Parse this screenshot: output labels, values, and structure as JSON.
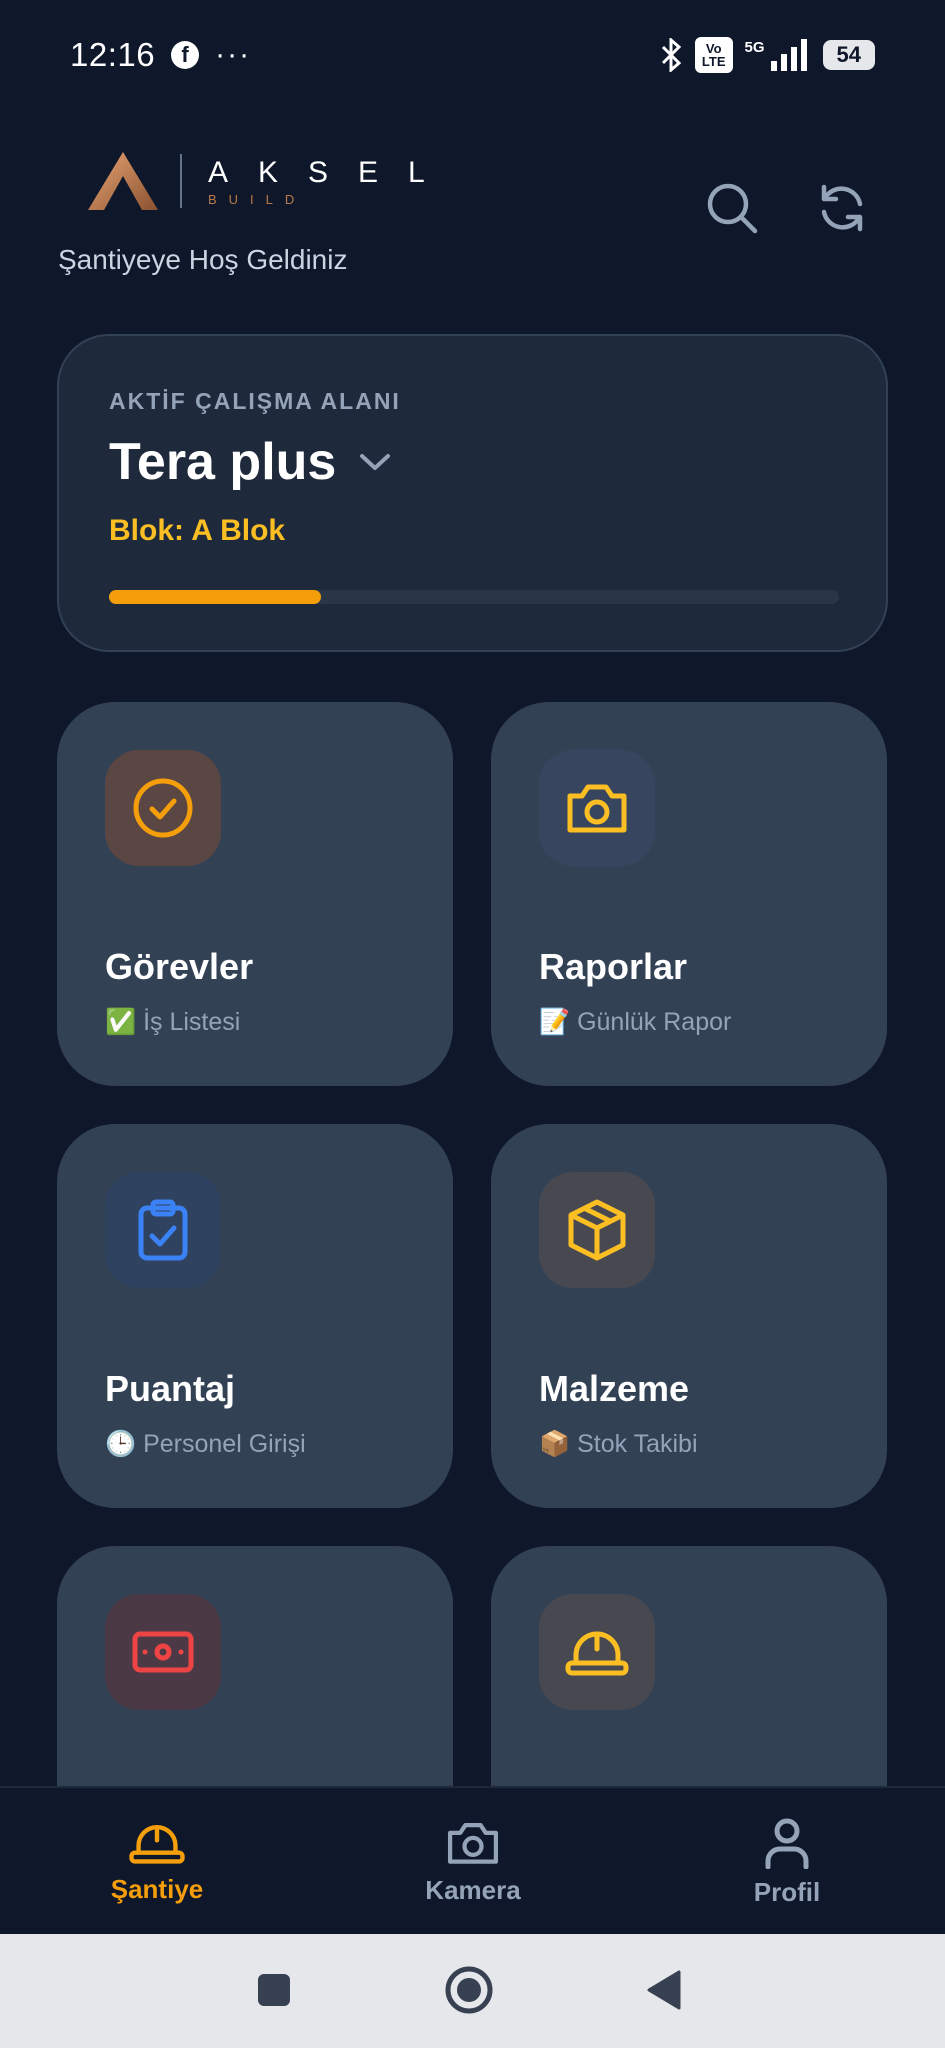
{
  "status_bar": {
    "time": "12:16",
    "fb_glyph": "f",
    "more": "···",
    "volte_top": "Vo",
    "volte_bottom": "LTE",
    "network": "5G",
    "battery": "54"
  },
  "header": {
    "logo_word": "AKSEL",
    "logo_sub": "BUILD",
    "welcome": "Şantiyeye Hoş Geldiniz",
    "icons": [
      "search-icon",
      "refresh-icon"
    ]
  },
  "workspace": {
    "label": "AKTİF ÇALIŞMA ALANI",
    "name": "Tera plus",
    "block": "Blok: A Blok",
    "progress": 0.29,
    "accent": "#f59e0b"
  },
  "tiles": [
    {
      "title": "Görevler",
      "subtitle": "✅ İş Listesi",
      "icon": "check-circle-icon",
      "color": "#f59e0b"
    },
    {
      "title": "Raporlar",
      "subtitle": "📝 Günlük Rapor",
      "icon": "camera-icon",
      "color": "#fbbf24"
    },
    {
      "title": "Puantaj",
      "subtitle": "🕒 Personel Girişi",
      "icon": "clipboard-check-icon",
      "color": "#3b82f6"
    },
    {
      "title": "Malzeme",
      "subtitle": "📦 Stok Takibi",
      "icon": "box-icon",
      "color": "#fbbf24"
    },
    {
      "title": "",
      "subtitle": "",
      "icon": "cash-icon",
      "color": "#ef4444"
    },
    {
      "title": "",
      "subtitle": "",
      "icon": "hard-hat-icon",
      "color": "#fbbf24"
    }
  ],
  "bottom_nav": [
    {
      "label": "Şantiye",
      "icon": "hard-hat-icon",
      "active": true
    },
    {
      "label": "Kamera",
      "icon": "camera-icon",
      "active": false
    },
    {
      "label": "Profil",
      "icon": "user-icon",
      "active": false
    }
  ],
  "colors": {
    "background": "#0f172a",
    "card": "#1e293b",
    "tile": "#334155",
    "accent": "#f59e0b",
    "block_text": "#fbbf24"
  }
}
